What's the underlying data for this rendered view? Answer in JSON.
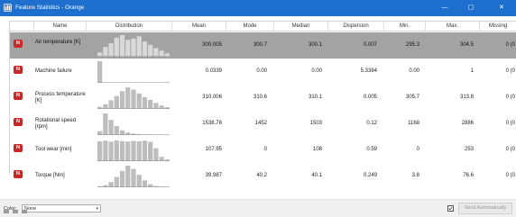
{
  "window": {
    "title": "Feature Statistics - Orange",
    "buttons": {
      "minimize": "—",
      "maximize": "▢",
      "close": "✕"
    },
    "accent_color": "#1f6fce"
  },
  "table": {
    "headers": {
      "name": "Name",
      "distribution": "Distribution",
      "mean": "Mean",
      "mode": "Mode",
      "median": "Median",
      "dispersion": "Dispersion",
      "min": "Min.",
      "max": "Max.",
      "missing": "Missing"
    },
    "rows": [
      {
        "icon_letter": "N",
        "name": "Air temperature [K]",
        "mean": "300.005",
        "mode": "300.7",
        "median": "300.1",
        "dispersion": "0.007",
        "min": "295.3",
        "max": "304.5",
        "missing": "0 (0",
        "selected": true,
        "histogram": [
          0.2,
          0.45,
          0.62,
          0.88,
          1.0,
          0.78,
          0.84,
          0.95,
          0.7,
          0.55,
          0.4,
          0.28,
          0.15
        ]
      },
      {
        "icon_letter": "N",
        "name": "Machine failure",
        "mean": "0.0339",
        "mode": "0.00",
        "median": "0.00",
        "dispersion": "5.3384",
        "min": "0.00",
        "max": "1",
        "missing": "0 (0",
        "selected": false,
        "histogram": [
          1.0,
          0.0,
          0.0,
          0.0,
          0.0,
          0.0,
          0.0,
          0.0,
          0.0,
          0.0,
          0.0,
          0.0,
          0.0
        ]
      },
      {
        "icon_letter": "N",
        "name": "Process temperature [K]",
        "mean": "310.006",
        "mode": "310.6",
        "median": "310.1",
        "dispersion": "0.005",
        "min": "305.7",
        "max": "313.8",
        "missing": "0 (0",
        "selected": false,
        "histogram": [
          0.1,
          0.22,
          0.4,
          0.6,
          0.82,
          1.0,
          0.9,
          0.72,
          0.55,
          0.42,
          0.28,
          0.16,
          0.08
        ]
      },
      {
        "icon_letter": "N",
        "name": "Rotational speed [rpm]",
        "mean": "1538.78",
        "mode": "1452",
        "median": "1503",
        "dispersion": "0.12",
        "min": "1168",
        "max": "2886",
        "missing": "0 (0",
        "selected": false,
        "histogram": [
          0.18,
          1.0,
          0.7,
          0.42,
          0.22,
          0.12,
          0.07,
          0.04,
          0.02,
          0.01,
          0.0,
          0.0,
          0.0
        ]
      },
      {
        "icon_letter": "N",
        "name": "Tool wear [min]",
        "mean": "107.95",
        "mode": "0",
        "median": "108",
        "dispersion": "0.59",
        "min": "0",
        "max": "253",
        "missing": "0 (0",
        "selected": false,
        "histogram": [
          0.92,
          0.95,
          0.9,
          0.96,
          0.93,
          0.91,
          0.94,
          0.92,
          0.95,
          0.9,
          0.6,
          0.2,
          0.08
        ]
      },
      {
        "icon_letter": "N",
        "name": "Torque [Nm]",
        "mean": "39.987",
        "mode": "40.2",
        "median": "40.1",
        "dispersion": "0.249",
        "min": "3.8",
        "max": "76.6",
        "missing": "0 (0",
        "selected": false,
        "histogram": [
          0.04,
          0.1,
          0.24,
          0.48,
          0.76,
          1.0,
          0.85,
          0.58,
          0.32,
          0.14,
          0.06,
          0.03,
          0.01
        ]
      }
    ],
    "bar_color": "#bdbdbd",
    "selected_bar_color": "#d9d9d9"
  },
  "bottom": {
    "color_label": "Color:",
    "color_value": "None",
    "send_automatically": "Send Automatically"
  }
}
